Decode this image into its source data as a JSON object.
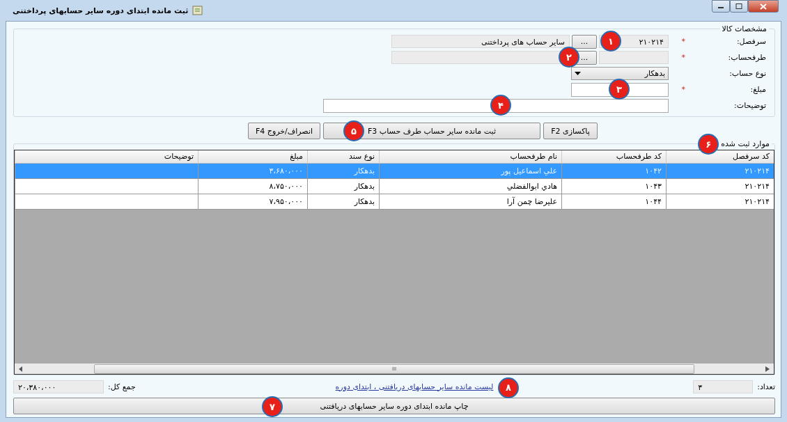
{
  "window": {
    "title": "ثبت مانده ابتدای دوره سایر حسابهای پرداختنی"
  },
  "form": {
    "legend": "مشخصات کالا",
    "fields": [
      {
        "kind": "lookup",
        "label": "سرفصل:",
        "required_mark": "*",
        "code": "۲۱۰۲۱۴",
        "browse": "...",
        "name": "سایر حساب های پرداختنی",
        "badge": "۱"
      },
      {
        "kind": "lookup",
        "label": "طرفحساب:",
        "required_mark": "*",
        "browse": "...",
        "badge": "۲"
      },
      {
        "kind": "select",
        "label": "نوع حساب:",
        "value": "بدهکار"
      },
      {
        "kind": "amount",
        "label": "مبلغ:",
        "required_mark": "*",
        "badge": "۳"
      },
      {
        "kind": "text",
        "label": "توضیحات:",
        "badge": "۴"
      }
    ]
  },
  "actions": [
    {
      "label": "پاکسازی F2"
    },
    {
      "label": "ثبت مانده سایر حساب طرف حساب F3",
      "badge": "۵"
    },
    {
      "label": "انصراف/خروج F4"
    }
  ],
  "registered": {
    "legend": "موارد ثبت شده",
    "badge": "۶",
    "columns": [
      "کد سرفصل",
      "کد طرفحساب",
      "نام طرفحساب",
      "نوع سند",
      "مبلغ",
      "توضیحات"
    ],
    "rows": [
      {
        "selected": true,
        "cells": [
          "۲۱۰۲۱۴",
          "۱۰۴۲",
          "علي اسماعيل پور",
          "بدهکار",
          "۳،۶۸۰،۰۰۰",
          ""
        ]
      },
      {
        "selected": false,
        "cells": [
          "۲۱۰۲۱۴",
          "۱۰۴۳",
          "هادي ابوالفضلي",
          "بدهکار",
          "۸،۷۵۰،۰۰۰",
          ""
        ]
      },
      {
        "selected": false,
        "cells": [
          "۲۱۰۲۱۴",
          "۱۰۴۴",
          "عليرضا چمن آرا",
          "بدهکار",
          "۷،۹۵۰،۰۰۰",
          ""
        ]
      }
    ],
    "scroll_grip": "III"
  },
  "footer": {
    "count_label": "تعداد:",
    "count": "۳",
    "link": "لیست مانده سایر حسابهای دریافتنی ، ابتدای دوره",
    "link_badge": "۸",
    "total_label": "جمع کل:",
    "total": "۲۰،۳۸۰،۰۰۰"
  },
  "print_button": {
    "label": "چاپ مانده ابتدای دوره سایر حسابهای دریافتنی",
    "badge": "۷"
  }
}
